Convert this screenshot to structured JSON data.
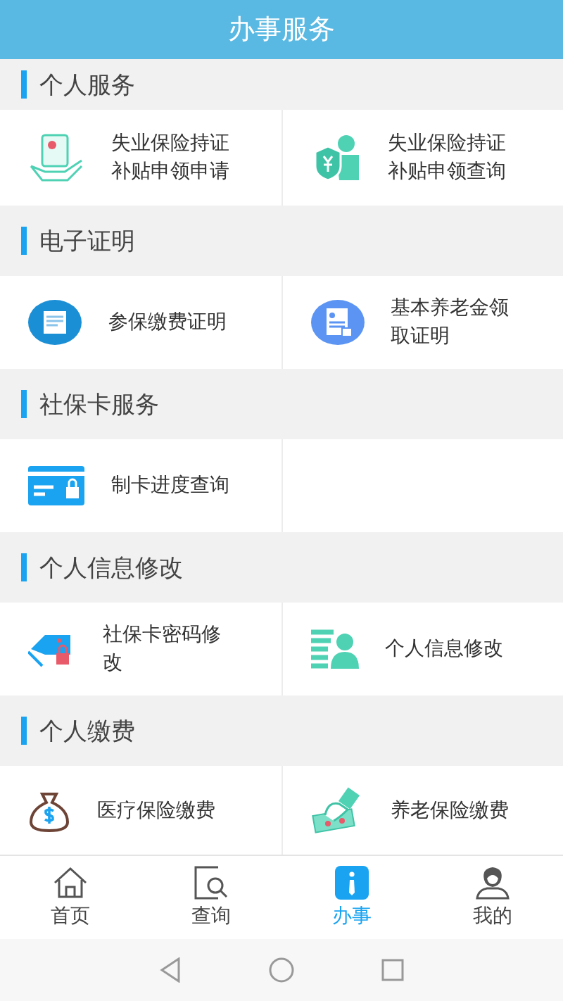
{
  "header": {
    "title": "办事服务"
  },
  "sections": [
    {
      "title": "个人服务",
      "items": [
        {
          "label": "失业保险持证补贴申领申请",
          "kind": "hand-certificate"
        },
        {
          "label": "失业保险持证补贴申领查询",
          "kind": "shield-person"
        }
      ]
    },
    {
      "title": "电子证明",
      "items": [
        {
          "label": "参保缴费证明",
          "kind": "document-circle"
        },
        {
          "label": "基本养老金领取证明",
          "kind": "id-circle"
        }
      ]
    },
    {
      "title": "社保卡服务",
      "items": [
        {
          "label": "制卡进度查询",
          "kind": "card-lock"
        }
      ]
    },
    {
      "title": "个人信息修改",
      "items": [
        {
          "label": "社保卡密码修改",
          "kind": "cards-lock"
        },
        {
          "label": "个人信息修改",
          "kind": "list-person"
        }
      ]
    },
    {
      "title": "个人缴费",
      "items": [
        {
          "label": "医疗保险缴费",
          "kind": "money-bag"
        },
        {
          "label": "养老保险缴费",
          "kind": "hand-cash"
        }
      ]
    }
  ],
  "tabs": [
    {
      "label": "首页",
      "kind": "home",
      "selected": false
    },
    {
      "label": "查询",
      "kind": "search",
      "selected": false
    },
    {
      "label": "办事",
      "kind": "info",
      "selected": true
    },
    {
      "label": "我的",
      "kind": "user",
      "selected": false
    }
  ]
}
